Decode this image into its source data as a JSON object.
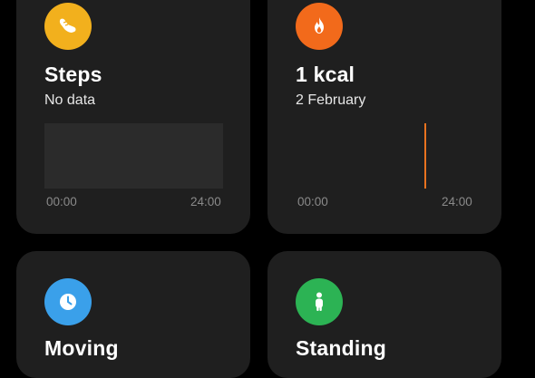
{
  "colors": {
    "background": "#000000",
    "card": "#1f1f1f",
    "steps_icon_bg": "#f2b01d",
    "calories_icon_bg": "#f26a1b",
    "moving_icon_bg": "#3aa0ea",
    "standing_icon_bg": "#2cb354",
    "calorie_bar": "#e8721f",
    "empty_chart": "#2b2b2b"
  },
  "cards": {
    "steps": {
      "icon": "shoe-icon",
      "title": "Steps",
      "subtitle": "No data",
      "axis_start": "00:00",
      "axis_end": "24:00"
    },
    "calories": {
      "icon": "flame-icon",
      "title": "1 kcal",
      "subtitle": "2 February",
      "axis_start": "00:00",
      "axis_end": "24:00",
      "activity_bar_time_fraction": 0.72
    },
    "moving": {
      "icon": "clock-icon",
      "title": "Moving"
    },
    "standing": {
      "icon": "standing-person-icon",
      "title": "Standing"
    }
  }
}
